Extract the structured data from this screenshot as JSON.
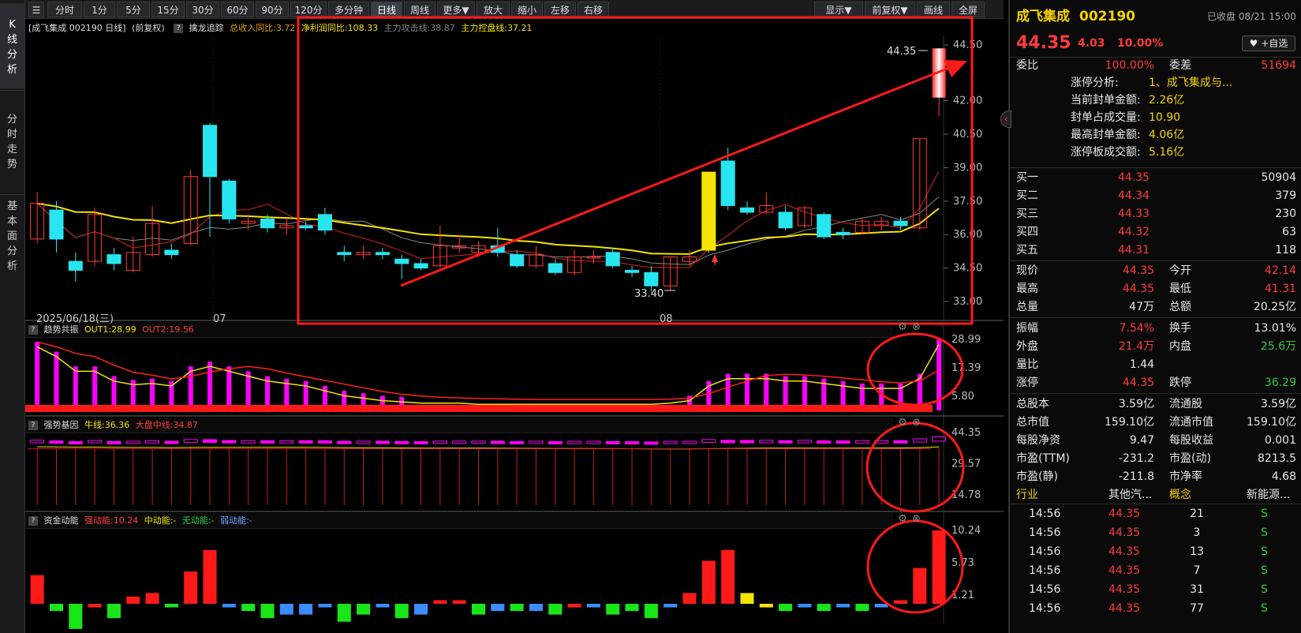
{
  "toolbar": {
    "buttons": [
      "分时",
      "1分",
      "5分",
      "15分",
      "30分",
      "60分",
      "90分",
      "120分",
      "多分钟",
      "日线",
      "周线",
      "更多▼",
      "放大",
      "缩小",
      "左移",
      "右移"
    ],
    "right_buttons": [
      "显示▼",
      "前复权▼",
      "画线",
      "全屏"
    ],
    "active": "日线"
  },
  "leftbar": {
    "items": [
      "K线分析",
      "分时走势",
      "基本面分析"
    ]
  },
  "main_header": {
    "title": "[成飞集成 002190 日线]",
    "adj": "(前复权)",
    "ind_name": "擒龙追踪",
    "rev": "总收入同比:3.72",
    "profit": "净利润同比:108.33",
    "attack": "主力攻击线:38.87",
    "control": "主力控盘线:37.21"
  },
  "price_axis": [
    "44.50",
    "42.00",
    "40.50",
    "39.00",
    "37.50",
    "36.00",
    "34.50",
    "33.00"
  ],
  "date_labels": [
    "2025/06/18(三)",
    "07",
    "08"
  ],
  "price_marks": {
    "high": "44.35",
    "low": "33.40"
  },
  "panel1": {
    "name": "趋势共振",
    "out1": "OUT1:28.99",
    "out2": "OUT2:19.56",
    "axis": [
      "28.99",
      "17.39",
      "5.80"
    ]
  },
  "panel2": {
    "name": "强势基因",
    "bull": "牛线:36.36",
    "market": "大盘中线:34.87",
    "axis": [
      "44.35",
      "29.57",
      "14.78"
    ]
  },
  "panel3": {
    "name": "资金动能",
    "strong": "强动能:10.24",
    "mid": "中动能:-",
    "none": "无动能:-",
    "weak": "弱动能:-",
    "axis": [
      "10.24",
      "5.73",
      "1.21"
    ]
  },
  "stock": {
    "name": "成飞集成",
    "code": "002190",
    "status": "已收盘 08/21 15:00",
    "price": "44.35",
    "change": "4.03",
    "pct": "10.00%",
    "watch_btn": "+自选"
  },
  "order_ratio": {
    "wb_label": "委比",
    "wb": "100.00%",
    "wc_label": "委差",
    "wc": "51694"
  },
  "limit": [
    {
      "label": "涨停分析:",
      "value": "1、成飞集成与..."
    },
    {
      "label": "当前封单金额:",
      "value": "2.26亿"
    },
    {
      "label": "封单占成交量:",
      "value": "10.90"
    },
    {
      "label": "最高封单金额:",
      "value": "4.06亿"
    },
    {
      "label": "涨停板成交额:",
      "value": "5.16亿"
    }
  ],
  "bids": [
    {
      "label": "买一",
      "price": "44.35",
      "vol": "50904"
    },
    {
      "label": "买二",
      "price": "44.34",
      "vol": "379"
    },
    {
      "label": "买三",
      "price": "44.33",
      "vol": "230"
    },
    {
      "label": "买四",
      "price": "44.32",
      "vol": "63"
    },
    {
      "label": "买五",
      "price": "44.31",
      "vol": "118"
    }
  ],
  "quote": [
    [
      {
        "l": "现价",
        "v": "44.35",
        "c": "red"
      },
      {
        "l": "今开",
        "v": "42.14",
        "c": "red"
      }
    ],
    [
      {
        "l": "最高",
        "v": "44.35",
        "c": "red"
      },
      {
        "l": "最低",
        "v": "41.31",
        "c": "red"
      }
    ],
    [
      {
        "l": "总量",
        "v": "47万",
        "c": "white"
      },
      {
        "l": "总额",
        "v": "20.25亿",
        "c": "white"
      }
    ],
    [
      {
        "l": "振幅",
        "v": "7.54%",
        "c": "red"
      },
      {
        "l": "换手",
        "v": "13.01%",
        "c": "white"
      }
    ],
    [
      {
        "l": "外盘",
        "v": "21.4万",
        "c": "red"
      },
      {
        "l": "内盘",
        "v": "25.6万",
        "c": "green"
      }
    ],
    [
      {
        "l": "量比",
        "v": "1.44",
        "c": "white"
      },
      {
        "l": "",
        "v": "",
        "c": "white"
      }
    ],
    [
      {
        "l": "涨停",
        "v": "44.35",
        "c": "red"
      },
      {
        "l": "跌停",
        "v": "36.29",
        "c": "green"
      }
    ],
    [
      {
        "l": "总股本",
        "v": "3.59亿",
        "c": "white"
      },
      {
        "l": "流通股",
        "v": "3.59亿",
        "c": "white"
      }
    ],
    [
      {
        "l": "总市值",
        "v": "159.10亿",
        "c": "white"
      },
      {
        "l": "流通市值",
        "v": "159.10亿",
        "c": "white"
      }
    ],
    [
      {
        "l": "每股净资",
        "v": "9.47",
        "c": "white"
      },
      {
        "l": "每股收益",
        "v": "0.001",
        "c": "white"
      }
    ],
    [
      {
        "l": "市盈(TTM)",
        "v": "-231.2",
        "c": "white"
      },
      {
        "l": "市盈(动)",
        "v": "8213.5",
        "c": "white"
      }
    ],
    [
      {
        "l": "市盈(静)",
        "v": "-211.8",
        "c": "white"
      },
      {
        "l": "市净率",
        "v": "4.68",
        "c": "white"
      }
    ]
  ],
  "industry": {
    "l1": "行业",
    "v1": "其他汽...",
    "l2": "概念",
    "v2": "新能源..."
  },
  "ticks": [
    {
      "t": "14:56",
      "p": "44.35",
      "v": "21",
      "s": "S"
    },
    {
      "t": "14:56",
      "p": "44.35",
      "v": "3",
      "s": "S"
    },
    {
      "t": "14:56",
      "p": "44.35",
      "v": "13",
      "s": "S"
    },
    {
      "t": "14:56",
      "p": "44.35",
      "v": "7",
      "s": "S"
    },
    {
      "t": "14:56",
      "p": "44.35",
      "v": "31",
      "s": "S"
    },
    {
      "t": "14:56",
      "p": "44.35",
      "v": "77",
      "s": "S"
    }
  ],
  "colors": {
    "up": "#ff3b3b",
    "down": "#27e6f0",
    "yellow": "#f5e400",
    "magenta": "#ff00ff",
    "annot": "#ff1a1a"
  },
  "candles": [
    {
      "o": 35.8,
      "c": 37.4,
      "h": 37.9,
      "l": 35.6
    },
    {
      "o": 37.1,
      "c": 35.8,
      "h": 37.5,
      "l": 35.2
    },
    {
      "o": 34.8,
      "c": 34.4,
      "h": 35.2,
      "l": 33.9
    },
    {
      "o": 34.8,
      "c": 36.9,
      "h": 37.2,
      "l": 34.6
    },
    {
      "o": 35.1,
      "c": 34.7,
      "h": 35.4,
      "l": 34.4
    },
    {
      "o": 34.4,
      "c": 35.2,
      "h": 35.9,
      "l": 34.3
    },
    {
      "o": 35.1,
      "c": 36.5,
      "h": 37.3,
      "l": 35.0
    },
    {
      "o": 35.3,
      "c": 35.1,
      "h": 35.6,
      "l": 34.9
    },
    {
      "o": 35.6,
      "c": 38.6,
      "h": 38.9,
      "l": 35.5
    },
    {
      "o": 40.9,
      "c": 38.6,
      "h": 41.0,
      "l": 35.9
    },
    {
      "o": 38.4,
      "c": 36.7,
      "h": 38.5,
      "l": 36.5
    },
    {
      "o": 36.5,
      "c": 36.6,
      "h": 36.9,
      "l": 36.2
    },
    {
      "o": 36.7,
      "c": 36.3,
      "h": 36.9,
      "l": 36.1
    },
    {
      "o": 36.3,
      "c": 36.4,
      "h": 36.7,
      "l": 36.0
    },
    {
      "o": 36.4,
      "c": 36.3,
      "h": 36.6,
      "l": 36.2
    },
    {
      "o": 36.9,
      "c": 36.2,
      "h": 37.2,
      "l": 36.0
    },
    {
      "o": 35.2,
      "c": 35.1,
      "h": 35.5,
      "l": 34.8
    },
    {
      "o": 35.1,
      "c": 35.2,
      "h": 35.5,
      "l": 34.9
    },
    {
      "o": 35.2,
      "c": 35.1,
      "h": 35.4,
      "l": 34.9
    },
    {
      "o": 34.9,
      "c": 34.7,
      "h": 35.1,
      "l": 34.0
    },
    {
      "o": 34.7,
      "c": 34.5,
      "h": 34.9,
      "l": 34.4
    },
    {
      "o": 34.6,
      "c": 35.5,
      "h": 36.4,
      "l": 34.5
    },
    {
      "o": 35.4,
      "c": 35.5,
      "h": 36.0,
      "l": 35.2
    },
    {
      "o": 35.2,
      "c": 35.5,
      "h": 35.7,
      "l": 35.0
    },
    {
      "o": 35.5,
      "c": 35.2,
      "h": 36.3,
      "l": 35.0
    },
    {
      "o": 35.1,
      "c": 34.6,
      "h": 35.3,
      "l": 34.5
    },
    {
      "o": 34.6,
      "c": 35.1,
      "h": 35.5,
      "l": 34.5
    },
    {
      "o": 34.7,
      "c": 34.3,
      "h": 34.9,
      "l": 34.2
    },
    {
      "o": 34.3,
      "c": 35.0,
      "h": 35.3,
      "l": 34.2
    },
    {
      "o": 35.0,
      "c": 35.0,
      "h": 35.3,
      "l": 34.7
    },
    {
      "o": 35.2,
      "c": 34.6,
      "h": 35.4,
      "l": 34.5
    },
    {
      "o": 34.4,
      "c": 34.3,
      "h": 34.6,
      "l": 34.1
    },
    {
      "o": 34.3,
      "c": 33.7,
      "h": 34.6,
      "l": 33.4
    },
    {
      "o": 33.7,
      "c": 35.0,
      "h": 35.0,
      "l": 33.5
    },
    {
      "o": 34.8,
      "c": 35.0,
      "h": 35.3,
      "l": 34.6
    },
    {
      "o": 35.3,
      "c": 38.8,
      "h": 38.8,
      "l": 35.2
    },
    {
      "o": 39.3,
      "c": 37.3,
      "h": 39.9,
      "l": 37.1
    },
    {
      "o": 37.2,
      "c": 37.0,
      "h": 37.5,
      "l": 36.9
    },
    {
      "o": 37.0,
      "c": 37.3,
      "h": 37.9,
      "l": 36.9
    },
    {
      "o": 37.0,
      "c": 36.3,
      "h": 37.3,
      "l": 36.2
    },
    {
      "o": 36.4,
      "c": 37.2,
      "h": 37.3,
      "l": 36.3
    },
    {
      "o": 36.9,
      "c": 35.9,
      "h": 37.0,
      "l": 35.8
    },
    {
      "o": 36.1,
      "c": 36.0,
      "h": 36.3,
      "l": 35.8
    },
    {
      "o": 36.1,
      "c": 36.6,
      "h": 36.7,
      "l": 36.0
    },
    {
      "o": 36.4,
      "c": 36.6,
      "h": 36.8,
      "l": 36.2
    },
    {
      "o": 36.6,
      "c": 36.4,
      "h": 36.8,
      "l": 36.2
    },
    {
      "o": 36.3,
      "c": 40.3,
      "h": 40.3,
      "l": 36.2
    },
    {
      "o": 42.14,
      "c": 44.35,
      "h": 44.35,
      "l": 41.31
    }
  ],
  "trend_out1": [
    28.0,
    24.0,
    18.0,
    18.0,
    14.0,
    12.5,
    13.0,
    12.0,
    18.0,
    20.0,
    18.0,
    16.0,
    14.0,
    13.0,
    12.0,
    10.0,
    8.0,
    7.0,
    6.0,
    5.5,
    5.0,
    5.0,
    5.0,
    4.5,
    4.5,
    4.5,
    4.5,
    4.5,
    4.5,
    4.5,
    4.5,
    4.5,
    4.5,
    5.0,
    6.0,
    12.0,
    15.0,
    15.0,
    15.0,
    14.0,
    14.0,
    13.0,
    12.0,
    11.0,
    11.0,
    11.0,
    15.0,
    28.99
  ],
  "money": [
    {
      "v": 4.0,
      "c": "r"
    },
    {
      "v": -1.0,
      "c": "g"
    },
    {
      "v": -3.5,
      "c": "g"
    },
    {
      "v": -0.5,
      "c": "r"
    },
    {
      "v": -2.0,
      "c": "g"
    },
    {
      "v": 1.0,
      "c": "r"
    },
    {
      "v": 1.5,
      "c": "r"
    },
    {
      "v": -0.5,
      "c": "g"
    },
    {
      "v": 4.5,
      "c": "r"
    },
    {
      "v": 7.5,
      "c": "r"
    },
    {
      "v": -0.5,
      "c": "b"
    },
    {
      "v": -1.0,
      "c": "g"
    },
    {
      "v": -2.0,
      "c": "g"
    },
    {
      "v": -1.5,
      "c": "b"
    },
    {
      "v": -1.5,
      "c": "b"
    },
    {
      "v": -0.5,
      "c": "b"
    },
    {
      "v": -2.5,
      "c": "g"
    },
    {
      "v": -1.5,
      "c": "g"
    },
    {
      "v": -0.5,
      "c": "b"
    },
    {
      "v": -2.0,
      "c": "g"
    },
    {
      "v": -1.5,
      "c": "b"
    },
    {
      "v": 0.5,
      "c": "r"
    },
    {
      "v": 0.5,
      "c": "r"
    },
    {
      "v": -1.5,
      "c": "g"
    },
    {
      "v": -1.0,
      "c": "b"
    },
    {
      "v": -1.0,
      "c": "g"
    },
    {
      "v": -1.0,
      "c": "b"
    },
    {
      "v": -1.5,
      "c": "g"
    },
    {
      "v": -0.5,
      "c": "r"
    },
    {
      "v": -0.5,
      "c": "b"
    },
    {
      "v": -1.5,
      "c": "g"
    },
    {
      "v": -1.0,
      "c": "g"
    },
    {
      "v": -2.0,
      "c": "g"
    },
    {
      "v": -0.5,
      "c": "b"
    },
    {
      "v": 1.5,
      "c": "r"
    },
    {
      "v": 6.0,
      "c": "r"
    },
    {
      "v": 7.5,
      "c": "r"
    },
    {
      "v": 1.5,
      "c": "y"
    },
    {
      "v": -0.5,
      "c": "y"
    },
    {
      "v": -1.0,
      "c": "g"
    },
    {
      "v": -0.5,
      "c": "b"
    },
    {
      "v": -1.0,
      "c": "g"
    },
    {
      "v": -0.5,
      "c": "b"
    },
    {
      "v": -1.0,
      "c": "g"
    },
    {
      "v": -0.5,
      "c": "b"
    },
    {
      "v": 0.5,
      "c": "r"
    },
    {
      "v": 5.0,
      "c": "r"
    },
    {
      "v": 10.24,
      "c": "r"
    }
  ]
}
